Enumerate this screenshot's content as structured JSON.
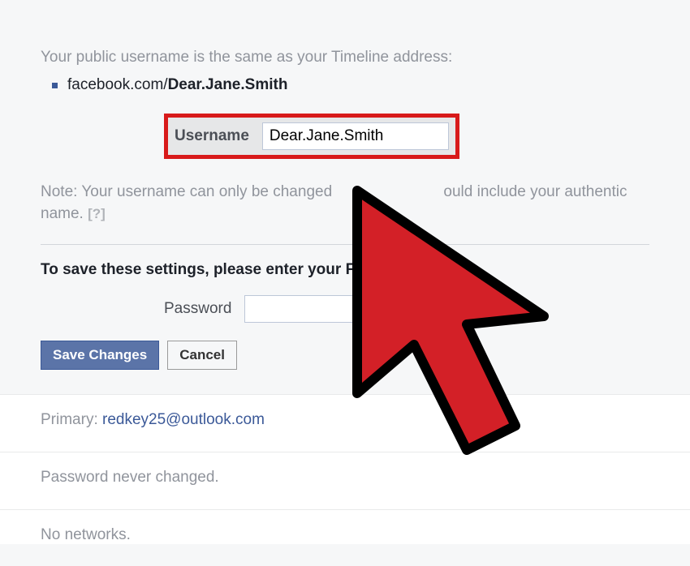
{
  "intro": "Your public username is the same as your Timeline address:",
  "url_prefix": "facebook.com/",
  "url_username": "Dear.Jane.Smith",
  "username_label": "Username",
  "username_value": "Dear.Jane.Smith",
  "note_before": "Note: Your username can only be changed ",
  "note_after": "ould include your authentic name. ",
  "help_icon": "[?]",
  "save_instruction": "To save these settings, please enter your Fa",
  "password_label": "Password",
  "password_value": "",
  "save_button": "Save Changes",
  "cancel_button": "Cancel",
  "primary_label": "Primary: ",
  "primary_email": "redkey25@outlook.com",
  "password_changed": "Password never changed.",
  "networks": "No networks."
}
